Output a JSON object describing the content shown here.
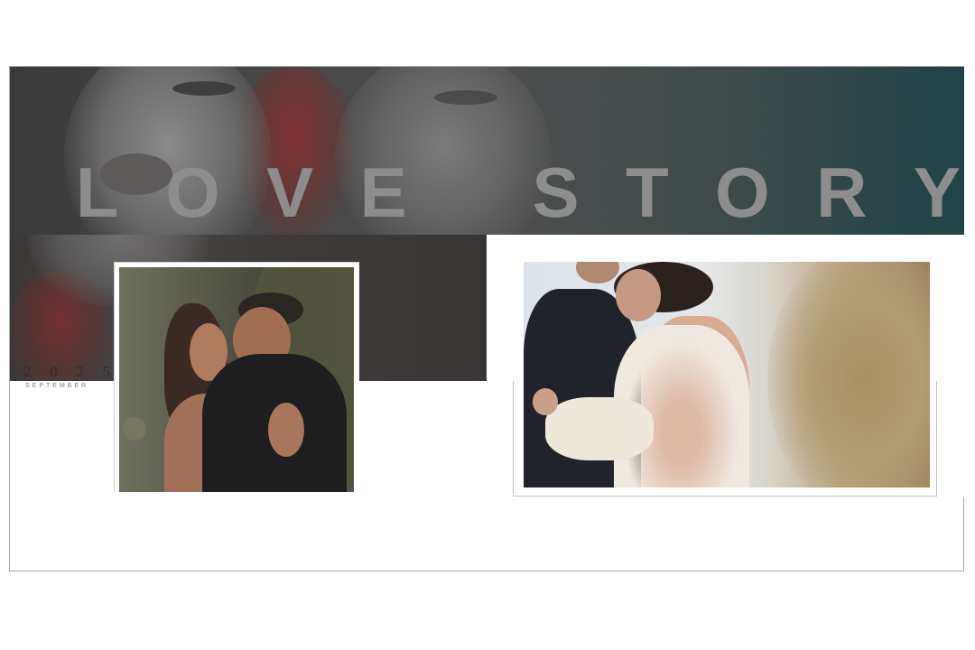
{
  "hero": {
    "title_letters": [
      "L",
      "O",
      "V",
      "E",
      "S",
      "T",
      "O",
      "R",
      "Y"
    ]
  },
  "date": {
    "year_digits": [
      "2",
      "0",
      "2",
      "5"
    ],
    "month": "SEPTEMBER"
  },
  "photos": [
    {
      "name": "couple-embrace-photo"
    },
    {
      "name": "bride-groom-photo"
    }
  ],
  "colors": {
    "banner_dark": "#474747",
    "banner_teal": "#1f4447",
    "title_gray": "#8d8d8d",
    "frame_border": "#a9a9a9"
  }
}
